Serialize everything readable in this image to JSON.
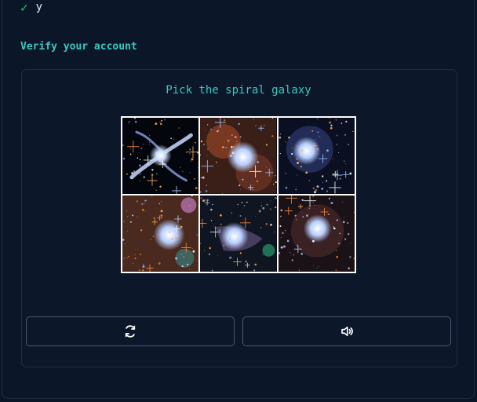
{
  "status": {
    "text": "y",
    "icon": "check-icon"
  },
  "verify": {
    "title": "Verify your account",
    "prompt": "Pick the spiral galaxy",
    "tiles": [
      {
        "label": "spiral galaxy"
      },
      {
        "label": "irregular galaxy"
      },
      {
        "label": "irregular galaxy"
      },
      {
        "label": "irregular galaxy"
      },
      {
        "label": "irregular galaxy"
      },
      {
        "label": "irregular galaxy"
      }
    ],
    "buttons": {
      "refresh_icon": "refresh-icon",
      "audio_icon": "speaker-icon"
    }
  },
  "colors": {
    "accent": "#3cc7bf",
    "background": "#0c1629",
    "check": "#34c06a"
  }
}
